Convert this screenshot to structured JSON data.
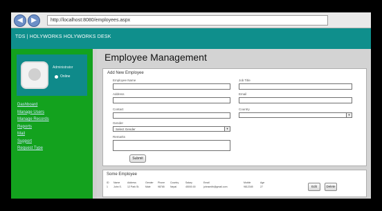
{
  "browser": {
    "url": "http://localhost:8080/employees.aspx",
    "back_glyph": "◀",
    "forward_glyph": "▶"
  },
  "banner": {
    "title": "TDS | HOLYWORKS HOLYWORKS DESK"
  },
  "sidebar": {
    "user_name": "Administrator",
    "online_label": "Online",
    "items": [
      {
        "label": "Dashboard"
      },
      {
        "label": "Manage Users"
      },
      {
        "label": "Manage Records"
      },
      {
        "label": "Reports"
      },
      {
        "label": "Mail"
      },
      {
        "label": "Support"
      },
      {
        "label": "Request Type"
      }
    ]
  },
  "main": {
    "title": "Employee Management",
    "form": {
      "title": "Add New Employee",
      "fields": {
        "employee_name": "Employee Name",
        "job_title": "Job Title",
        "address": "Address",
        "email": "Email",
        "phone": "Contact",
        "country": "Country",
        "gender": "Gender",
        "gender_value": "Select Gender",
        "remarks": "Remarks"
      },
      "submit_label": "Submit"
    },
    "list": {
      "title": "Some Employee",
      "headers": [
        "ID",
        "Name",
        "Address",
        "Gender",
        "Phone",
        "Country",
        "Salary",
        "Email",
        "Mobile",
        "Age"
      ],
      "rows": [
        [
          "1",
          "John S.",
          "12 Park St.",
          "Male",
          "98765",
          "Nepal",
          "45000.00",
          "johnsmith@gmail.com",
          "9812345",
          "27"
        ]
      ],
      "edit_label": "Edit",
      "delete_label": "Delete"
    }
  }
}
